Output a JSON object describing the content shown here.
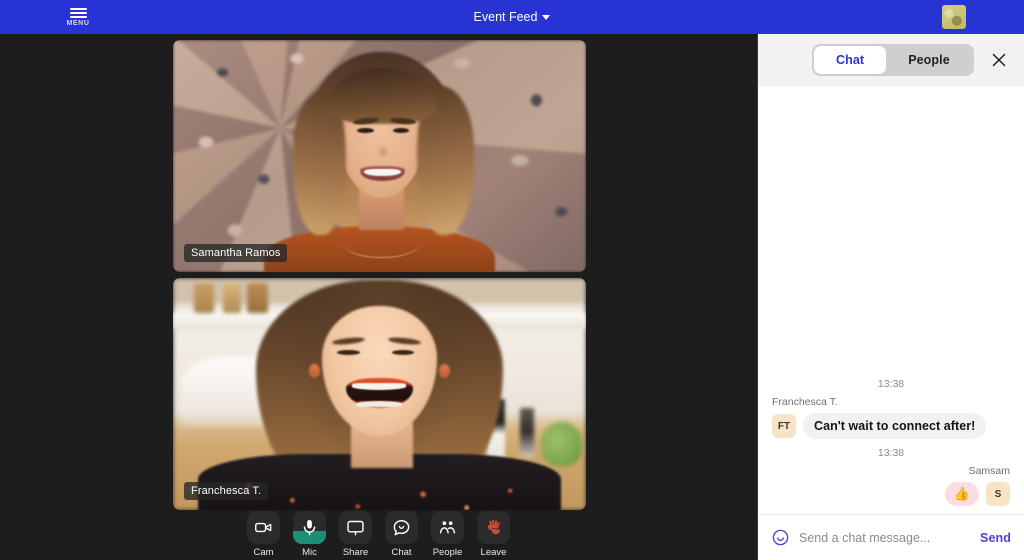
{
  "topbar": {
    "menu_label": "MENU",
    "menu_icon": "hamburger-icon",
    "title": "Event Feed",
    "title_caret_icon": "chevron-down-icon",
    "thumbnail_icon": "self-view-thumbnail",
    "background_color": "#2833d4"
  },
  "stage": {
    "background_color": "#1d1d1d",
    "tiles": [
      {
        "name": "Samantha Ramos",
        "scene": "woman-smiling-granite-wall"
      },
      {
        "name": "Franchesca T.",
        "scene": "woman-laughing-kitchen"
      }
    ]
  },
  "toolbar": {
    "items": [
      {
        "label": "Cam",
        "icon": "video-camera-icon",
        "state": "on"
      },
      {
        "label": "Mic",
        "icon": "microphone-icon",
        "state": "on",
        "level_color": "#1d8f74"
      },
      {
        "label": "Share",
        "icon": "monitor-screen-icon",
        "state": "off"
      },
      {
        "label": "Chat",
        "icon": "chat-bubble-icon",
        "state": "off"
      },
      {
        "label": "People",
        "icon": "people-icon",
        "state": "off"
      },
      {
        "label": "Leave",
        "icon": "waving-hand-icon",
        "state": "off"
      }
    ]
  },
  "chat": {
    "tabs": [
      {
        "label": "Chat",
        "active": true
      },
      {
        "label": "People",
        "active": false
      }
    ],
    "close_icon": "close-icon",
    "active_tab_color": "#2833d4",
    "messages": [
      {
        "time": "13:38",
        "author": "Franchesca T.",
        "avatar_initials": "FT",
        "text": "Can't wait to connect after!",
        "side": "left",
        "type": "text"
      },
      {
        "time": "13:38",
        "author": "Samsam",
        "avatar_initials": "S",
        "text": "👍",
        "side": "right",
        "type": "emoji"
      }
    ],
    "input": {
      "emoji_icon": "smiley-face-icon",
      "value": "",
      "placeholder": "Send a chat message...",
      "send_label": "Send"
    }
  }
}
